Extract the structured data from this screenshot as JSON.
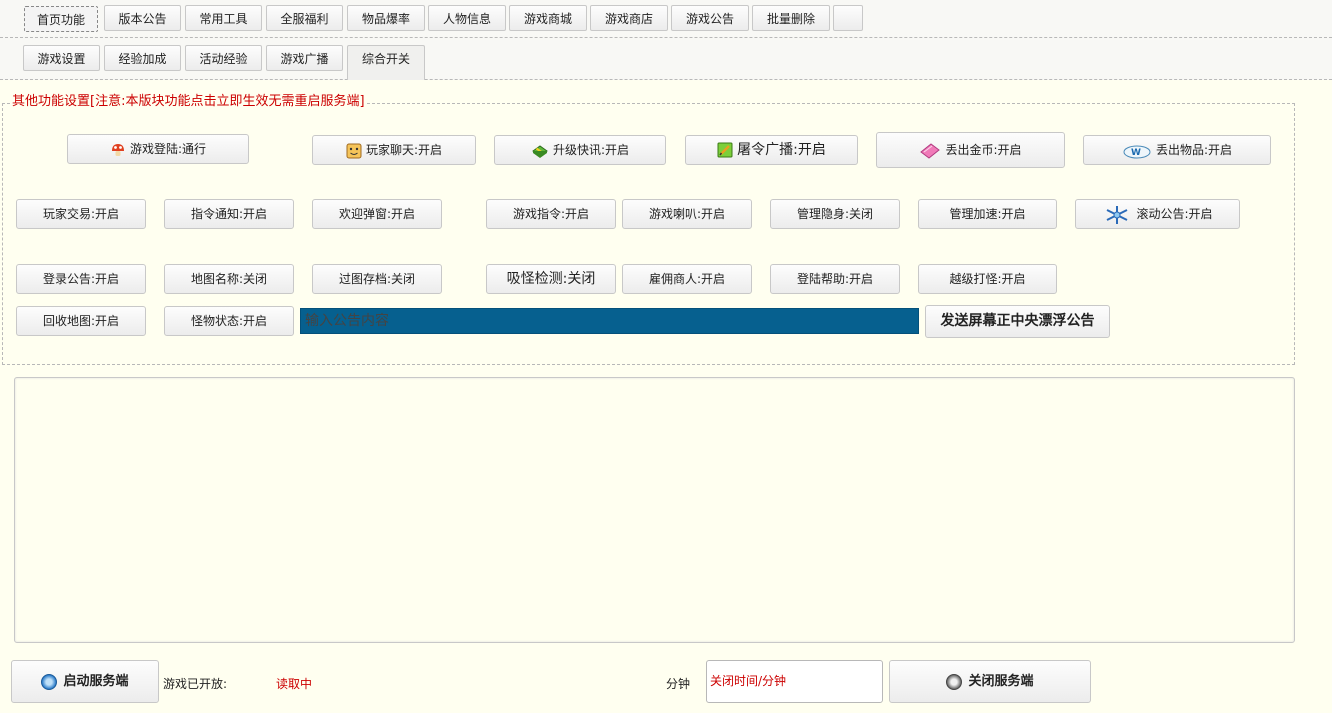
{
  "top_tabs": [
    "首页功能",
    "版本公告",
    "常用工具",
    "全服福利",
    "物品爆率",
    "人物信息",
    "游戏商城",
    "游戏商店",
    "游戏公告",
    "批量删除",
    ""
  ],
  "sub_tabs": [
    "游戏设置",
    "经验加成",
    "活动经验",
    "游戏广播",
    "综合开关"
  ],
  "panel_title": "其他功能设置[注意:本版块功能点击立即生效无需重启服务端]",
  "row1": {
    "login_pass": "游戏登陆:通行",
    "player_chat": "玩家聊天:开启",
    "levelup_news": "升级快讯:开启",
    "slaughter_broadcast": "屠令广播:开启",
    "drop_gold": "丢出金币:开启",
    "drop_item": "丢出物品:开启"
  },
  "row2": {
    "player_trade": "玩家交易:开启",
    "command_notify": "指令通知:开启",
    "welcome_popup": "欢迎弹窗:开启",
    "game_command": "游戏指令:开启",
    "game_horn": "游戏喇叭:开启",
    "admin_stealth": "管理隐身:关闭",
    "admin_speed": "管理加速:开启",
    "scroll_notice": "滚动公告:开启"
  },
  "row3": {
    "login_notice": "登录公告:开启",
    "map_name": "地图名称:关闭",
    "map_save": "过图存档:关闭",
    "monster_pull_check": "吸怪检测:关闭",
    "hired_merchant": "雇佣商人:开启",
    "login_help": "登陆帮助:开启",
    "overlevel_hunt": "越级打怪:开启"
  },
  "row4": {
    "recycle_map": "回收地图:开启",
    "monster_status": "怪物状态:开启"
  },
  "notice_input_placeholder": "输入公告内容",
  "send_notice_label": "发送屏幕正中央漂浮公告",
  "bottom": {
    "start_server": "启动服务端",
    "game_open_label": "游戏已开放:",
    "status": "读取中",
    "minutes_label": "分钟",
    "close_time_placeholder": "关闭时间/分钟",
    "stop_server": "关闭服务端"
  },
  "colors": {
    "background": "#fffff0",
    "notice_input_bg": "#06608f",
    "warning_red": "#cc0000"
  },
  "icons": {
    "login": "mushroom-icon",
    "chat": "smiley-face-icon",
    "levelup": "gift-box-icon",
    "broadcast": "green-notepad-icon",
    "gold": "pink-eraser-icon",
    "item": "cloud-cap-icon",
    "scroll": "blue-snowflake-icon",
    "start": "power-blue-icon",
    "stop": "power-gray-icon"
  }
}
